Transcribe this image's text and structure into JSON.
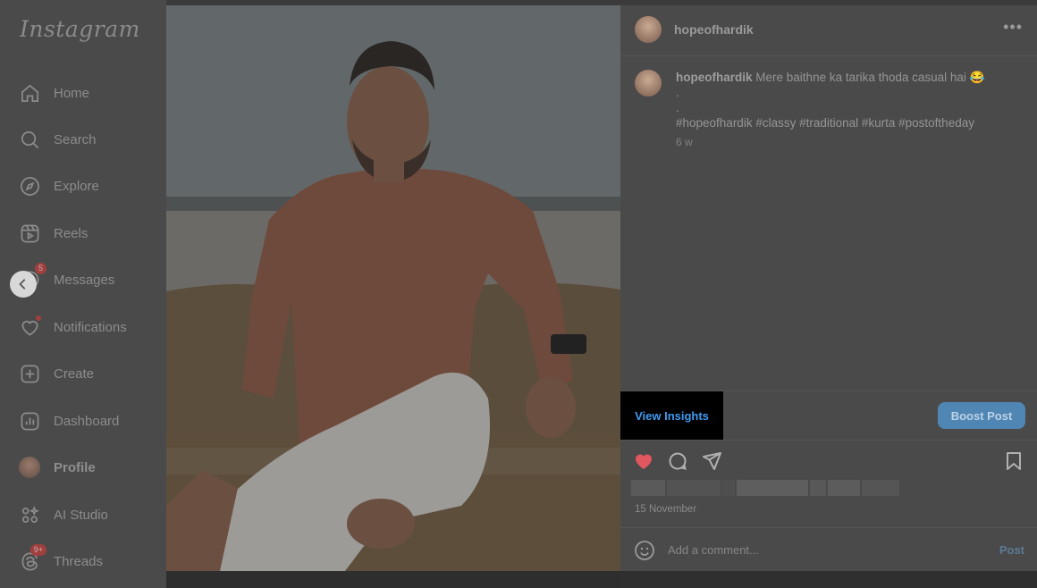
{
  "sidebar": {
    "logo": "Instagram",
    "items": [
      {
        "label": "Home",
        "icon": "home-icon"
      },
      {
        "label": "Search",
        "icon": "search-icon"
      },
      {
        "label": "Explore",
        "icon": "compass-icon"
      },
      {
        "label": "Reels",
        "icon": "reels-icon"
      },
      {
        "label": "Messages",
        "icon": "messenger-icon",
        "badge": "5"
      },
      {
        "label": "Notifications",
        "icon": "heart-icon"
      },
      {
        "label": "Create",
        "icon": "plus-square-icon"
      },
      {
        "label": "Dashboard",
        "icon": "dashboard-icon"
      },
      {
        "label": "Profile",
        "icon": "avatar"
      },
      {
        "label": "AI Studio",
        "icon": "ai-studio-icon"
      },
      {
        "label": "Threads",
        "icon": "threads-icon",
        "badge": "9+"
      }
    ]
  },
  "post": {
    "username": "hopeofhardik",
    "more_label": "•••",
    "caption_user": "hopeofhardik",
    "caption_text": "Mere baithne ka tarika thoda casual hai 😂",
    "caption_line2": ".",
    "caption_line3": ".",
    "hashtags": "#hopeofhardik #classy #traditional #kurta #postoftheday",
    "time_ago": "6 w",
    "view_insights_label": "View Insights",
    "boost_label": "Boost Post",
    "liked": true,
    "date": "15 November",
    "comment_placeholder": "Add a comment...",
    "post_label": "Post"
  },
  "colors": {
    "accent": "#3f9bf2",
    "boost_bg": "#4f86b4",
    "like_red": "#e0575f"
  }
}
